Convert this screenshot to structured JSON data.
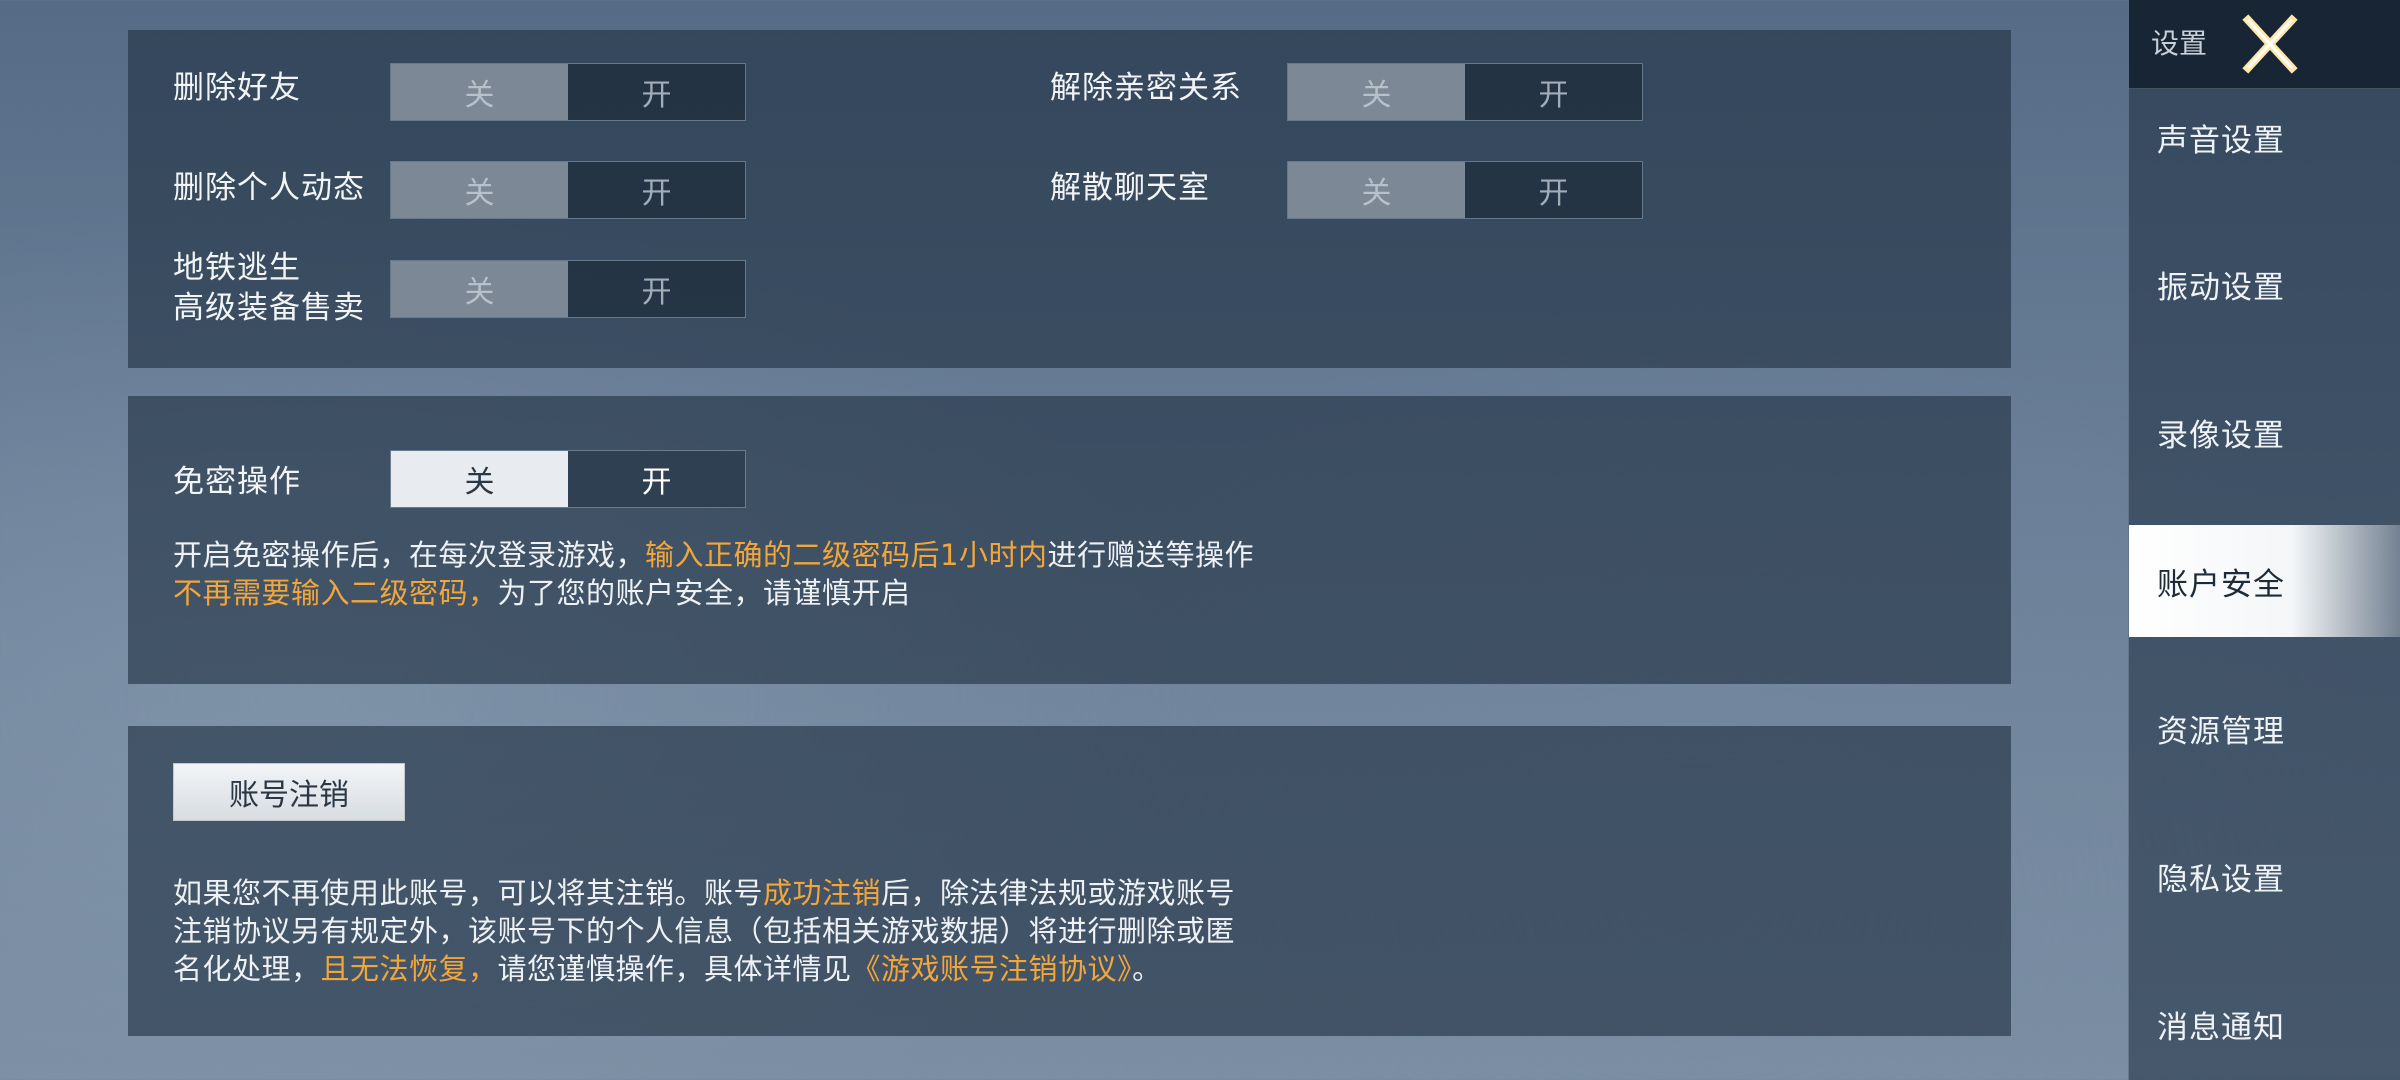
{
  "social_settings": {
    "items": [
      {
        "label": "删除好友",
        "off": "关",
        "on": "开"
      },
      {
        "label": "删除个人动态",
        "off": "关",
        "on": "开"
      },
      {
        "label_line1": "地铁逃生",
        "label_line2": "高级装备售卖",
        "off": "关",
        "on": "开"
      },
      {
        "label": "解除亲密关系",
        "off": "关",
        "on": "开"
      },
      {
        "label": "解散聊天室",
        "off": "关",
        "on": "开"
      }
    ]
  },
  "password_free": {
    "label": "免密操作",
    "off": "关",
    "on": "开",
    "selected": "关",
    "desc_line1": {
      "a": "开启免密操作后，在每次登录游戏，",
      "b": "输入正确的二级密码后1小时内",
      "c": "进行赠送等操作"
    },
    "desc_line2": {
      "a": "不再需要输入二级密码，",
      "b": "为了您的账户安全，请谨慎开启"
    }
  },
  "account_cancel": {
    "button_label": "账号注销",
    "desc_line1": {
      "a": "如果您不再使用此账号，可以将其注销。账号",
      "b": "成功注销",
      "c": "后，除法律法规或游戏账号"
    },
    "desc_line2": "注销协议另有规定外，该账号下的个人信息（包括相关游戏数据）将进行删除或匿",
    "desc_line3": {
      "a": "名化处理，",
      "b": "且无法恢复，",
      "c": "请您谨慎操作，具体详情见",
      "d": "《游戏账号注销协议》",
      "e": "。"
    }
  },
  "sidebar": {
    "title": "设置",
    "selected": "账户安全",
    "items": [
      "声音设置",
      "振动设置",
      "录像设置",
      "账户安全",
      "资源管理",
      "隐私设置",
      "消息通知"
    ]
  },
  "colors": {
    "highlight": "#f2a63a",
    "panel": "#203042"
  },
  "icons": {
    "close": "close-icon"
  }
}
